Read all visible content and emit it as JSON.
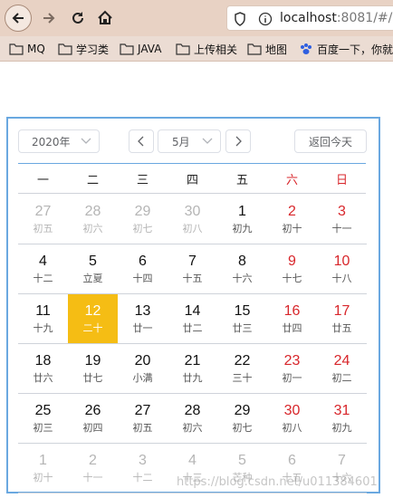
{
  "browser": {
    "url_host": "localhost",
    "url_rest": ":8081/#/",
    "bookmarks": [
      "MQ",
      "学习类",
      "JAVA",
      "上传相关",
      "地图",
      "百度一下，你就"
    ]
  },
  "calendar": {
    "year_label": "2020年",
    "month_label": "5月",
    "today_label": "返回今天",
    "weekdays": [
      "一",
      "二",
      "三",
      "四",
      "五",
      "六",
      "日"
    ],
    "days": [
      {
        "d": "27",
        "l": "初五"
      },
      {
        "d": "28",
        "l": "初六"
      },
      {
        "d": "29",
        "l": "初七"
      },
      {
        "d": "30",
        "l": "初八"
      },
      {
        "d": "1",
        "l": "初九"
      },
      {
        "d": "2",
        "l": "初十"
      },
      {
        "d": "3",
        "l": "十一"
      },
      {
        "d": "4",
        "l": "十二"
      },
      {
        "d": "5",
        "l": "立夏"
      },
      {
        "d": "6",
        "l": "十四"
      },
      {
        "d": "7",
        "l": "十五"
      },
      {
        "d": "8",
        "l": "十六"
      },
      {
        "d": "9",
        "l": "十七"
      },
      {
        "d": "10",
        "l": "十八"
      },
      {
        "d": "11",
        "l": "十九"
      },
      {
        "d": "12",
        "l": "二十"
      },
      {
        "d": "13",
        "l": "廿一"
      },
      {
        "d": "14",
        "l": "廿二"
      },
      {
        "d": "15",
        "l": "廿三"
      },
      {
        "d": "16",
        "l": "廿四"
      },
      {
        "d": "17",
        "l": "廿五"
      },
      {
        "d": "18",
        "l": "廿六"
      },
      {
        "d": "19",
        "l": "廿七"
      },
      {
        "d": "20",
        "l": "小满"
      },
      {
        "d": "21",
        "l": "廿九"
      },
      {
        "d": "22",
        "l": "三十"
      },
      {
        "d": "23",
        "l": "初一"
      },
      {
        "d": "24",
        "l": "初二"
      },
      {
        "d": "25",
        "l": "初三"
      },
      {
        "d": "26",
        "l": "初四"
      },
      {
        "d": "27",
        "l": "初五"
      },
      {
        "d": "28",
        "l": "初六"
      },
      {
        "d": "29",
        "l": "初七"
      },
      {
        "d": "30",
        "l": "初八"
      },
      {
        "d": "31",
        "l": "初九"
      },
      {
        "d": "1",
        "l": "初十"
      },
      {
        "d": "2",
        "l": "十一"
      },
      {
        "d": "3",
        "l": "十二"
      },
      {
        "d": "4",
        "l": "十三"
      },
      {
        "d": "5",
        "l": "芒种"
      },
      {
        "d": "6",
        "l": "十五"
      },
      {
        "d": "7",
        "l": "十六"
      }
    ],
    "selected_day": "12"
  },
  "watermark": "https://blog.csdn.net/u011384601",
  "colors": {
    "accent": "#f5bd14",
    "weekend": "#d8262b",
    "border": "#6aa8e0"
  }
}
